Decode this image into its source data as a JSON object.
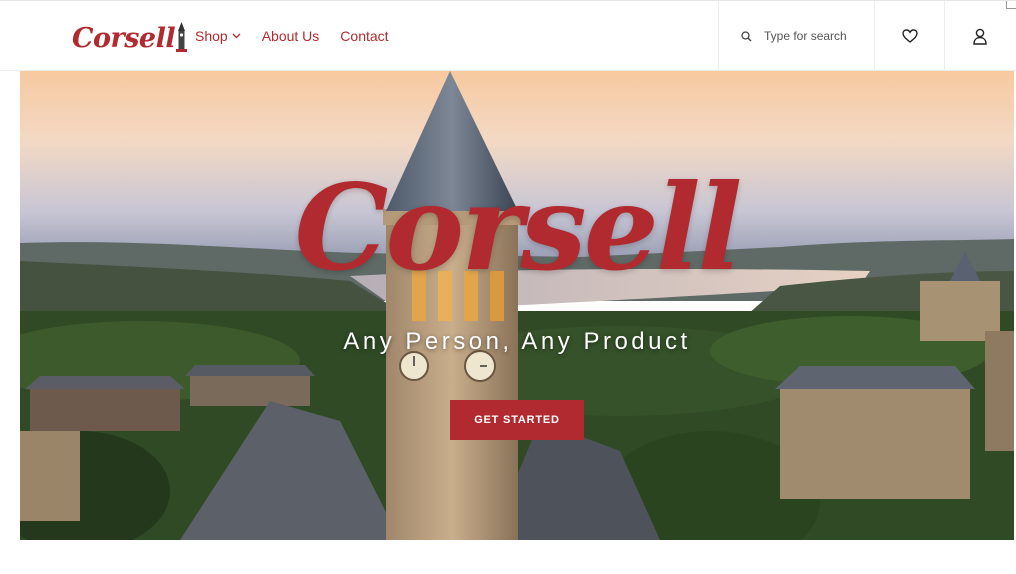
{
  "brand": {
    "name": "Corsell",
    "accent_color": "#b12a2f"
  },
  "nav": {
    "items": [
      {
        "label": "Shop",
        "has_dropdown": true
      },
      {
        "label": "About Us",
        "has_dropdown": false
      },
      {
        "label": "Contact",
        "has_dropdown": false
      }
    ]
  },
  "search": {
    "placeholder": "Type for search"
  },
  "header_icons": [
    "search-icon",
    "heart-icon",
    "user-icon"
  ],
  "hero": {
    "title": "Corsell",
    "subtitle": "Any Person, Any Product",
    "cta_label": "GET STARTED"
  }
}
